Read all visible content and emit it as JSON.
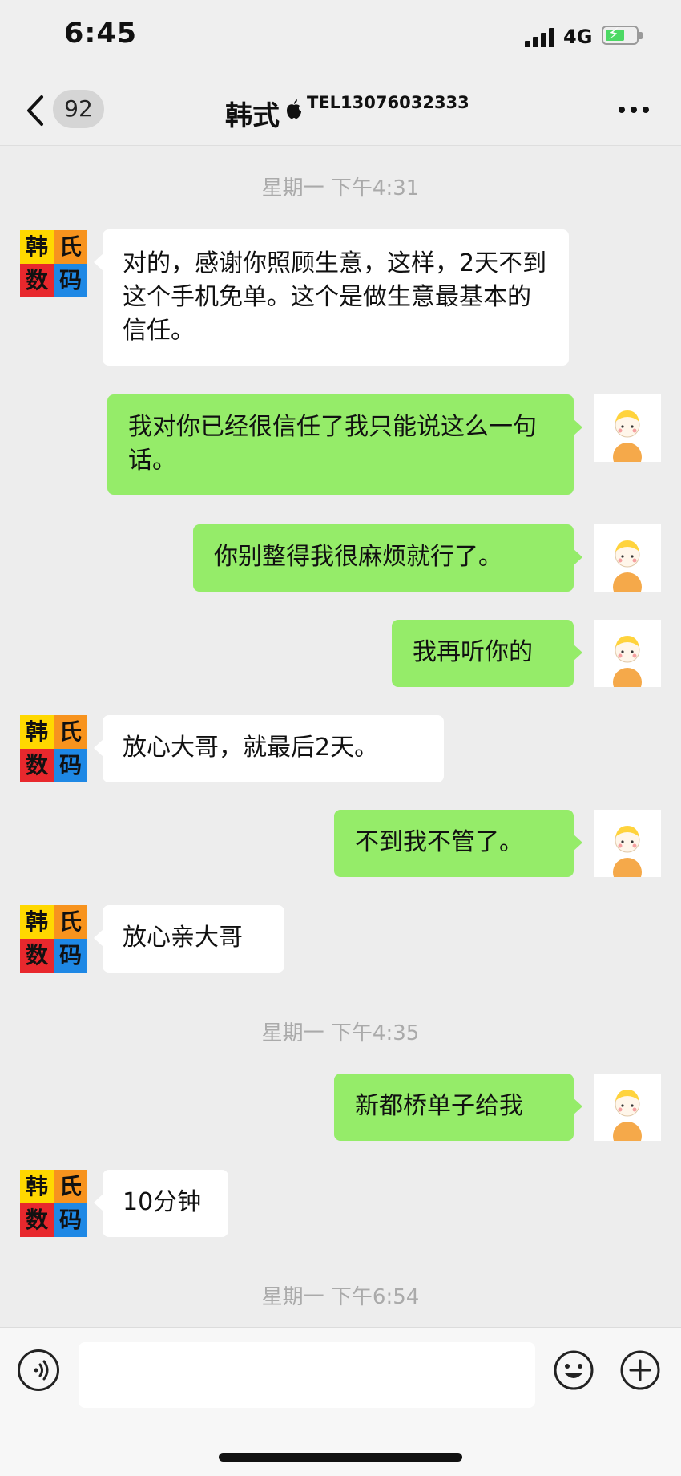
{
  "status_bar": {
    "time": "6:45",
    "network": "4G"
  },
  "nav": {
    "unread_count": "92",
    "title": "韩式",
    "subtitle": "TEL13076032333"
  },
  "avatar_contact": {
    "chars": [
      "韩",
      "氏",
      "数",
      "码"
    ]
  },
  "chat": {
    "timestamps": [
      "星期一 下午4:31",
      "星期一 下午4:35",
      "星期一 下午6:54"
    ],
    "messages": [
      {
        "from": "contact",
        "text": "对的，感谢你照顾生意，这样，2天不到这个手机免单。这个是做生意最基本的信任。"
      },
      {
        "from": "me",
        "text": "我对你已经很信任了我只能说这么一句话。"
      },
      {
        "from": "me",
        "text": "你别整得我很麻烦就行了。"
      },
      {
        "from": "me",
        "text": "我再听你的"
      },
      {
        "from": "contact",
        "text": "放心大哥，就最后2天。"
      },
      {
        "from": "me",
        "text": "不到我不管了。"
      },
      {
        "from": "contact",
        "text": "放心亲大哥"
      },
      {
        "from": "me",
        "text": "新都桥单子给我"
      },
      {
        "from": "contact",
        "text": "10分钟"
      }
    ]
  },
  "input_bar": {
    "value": ""
  },
  "icons": {
    "back": "chevron-left-icon",
    "more": "ellipsis-icon",
    "voice": "voice-icon",
    "emoji": "emoji-icon",
    "plus": "plus-icon"
  },
  "colors": {
    "outgoing_bubble": "#95ec69",
    "incoming_bubble": "#ffffff",
    "background": "#ededed",
    "timestamp_text": "#aaaaaa"
  }
}
